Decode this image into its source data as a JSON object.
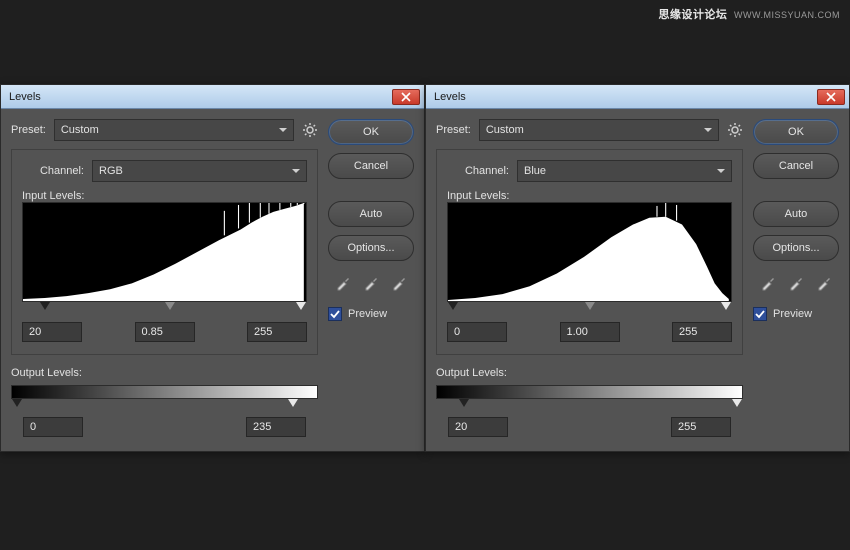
{
  "watermark": {
    "text": "思缘设计论坛",
    "url": "WWW.MISSYUAN.COM"
  },
  "dialogs": [
    {
      "title": "Levels",
      "preset_label": "Preset:",
      "preset_value": "Custom",
      "channel_label": "Channel:",
      "channel_value": "RGB",
      "input_levels_label": "Input Levels:",
      "input": {
        "black": "20",
        "gamma": "0.85",
        "white": "255"
      },
      "output_levels_label": "Output Levels:",
      "output": {
        "black": "0",
        "white": "235"
      },
      "histogram_style": "rising",
      "buttons": {
        "ok": "OK",
        "cancel": "Cancel",
        "auto": "Auto",
        "options": "Options..."
      },
      "preview_label": "Preview"
    },
    {
      "title": "Levels",
      "preset_label": "Preset:",
      "preset_value": "Custom",
      "channel_label": "Channel:",
      "channel_value": "Blue",
      "input_levels_label": "Input Levels:",
      "input": {
        "black": "0",
        "gamma": "1.00",
        "white": "255"
      },
      "output_levels_label": "Output Levels:",
      "output": {
        "black": "20",
        "white": "255"
      },
      "histogram_style": "mound",
      "buttons": {
        "ok": "OK",
        "cancel": "Cancel",
        "auto": "Auto",
        "options": "Options..."
      },
      "preview_label": "Preview"
    }
  ]
}
